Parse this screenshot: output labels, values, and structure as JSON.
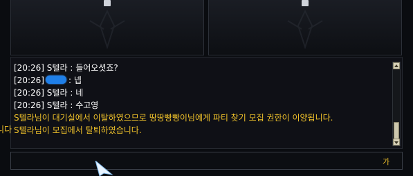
{
  "chat": {
    "lines": [
      {
        "time": "[20:26]",
        "speaker": "S텔라",
        "sep": ":",
        "text": "들어오셧죠?"
      },
      {
        "time": "[20:26]",
        "speaker": "",
        "sep": ":",
        "text": "넵"
      },
      {
        "time": "[20:26]",
        "speaker": "S텔라",
        "sep": ":",
        "text": "네"
      },
      {
        "time": "[20:26]",
        "speaker": "S텔라",
        "sep": ":",
        "text": "수고영"
      }
    ],
    "system": [
      "S텔라님이 대기실에서 이탈하였으므로 땅땅빵빵이님에게 파티 찾기 모집 권한이 이양됩니다.",
      "S텔라님이 모집에서 탈퇴하였습니다."
    ],
    "edge_fragment": "니다"
  },
  "input": {
    "value": "",
    "ime_mode": "가"
  },
  "colors": {
    "system_text": "#f0c22a",
    "chat_text": "#ffffff",
    "redaction": "#1f7fe8"
  },
  "icons": {
    "slot_lock": "lock-icon",
    "cursor": "mouse-pointer-icon"
  }
}
